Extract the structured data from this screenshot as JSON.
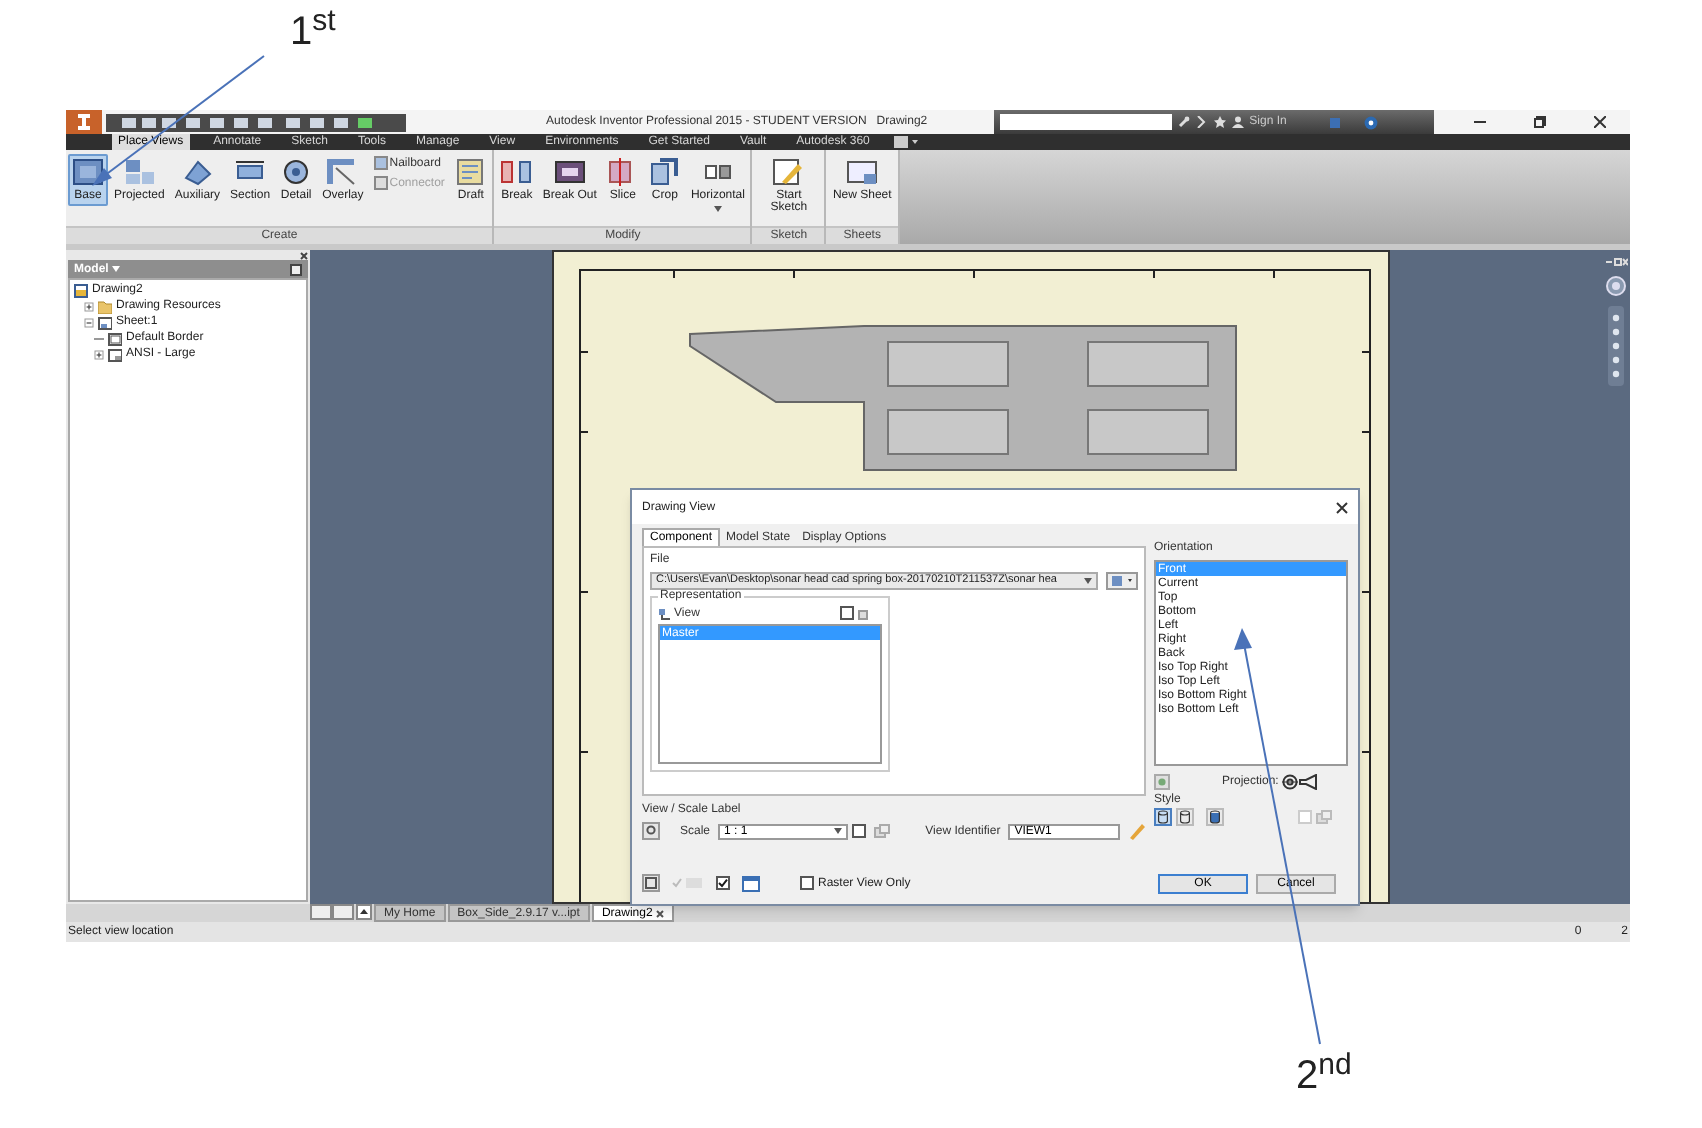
{
  "annotations": [
    {
      "text": "1$^{st}$"
    },
    {
      "text": "2$^{nd}$"
    }
  ],
  "title_bar": {
    "app_title": "Autodesk Inventor Professional 2015 - STUDENT VERSION",
    "document": "Drawing2",
    "sign_in": "Sign In"
  },
  "ribbon_tabs": [
    {
      "label": "Place Views",
      "selected": true
    },
    {
      "label": "Annotate",
      "selected": false
    },
    {
      "label": "Sketch",
      "selected": false
    },
    {
      "label": "Tools",
      "selected": false
    },
    {
      "label": "Manage",
      "selected": false
    },
    {
      "label": "View",
      "selected": false
    },
    {
      "label": "Environments",
      "selected": false
    },
    {
      "label": "Get Started",
      "selected": false
    },
    {
      "label": "Vault",
      "selected": false
    },
    {
      "label": "Autodesk 360",
      "selected": false
    }
  ],
  "ribbon_groups": [
    {
      "label": "Create",
      "items": [
        {
          "kind": "large",
          "label": "Base",
          "selected": true
        },
        {
          "kind": "large",
          "label": "Projected",
          "selected": false
        },
        {
          "kind": "large",
          "label": "Auxiliary",
          "selected": false
        },
        {
          "kind": "large",
          "label": "Section",
          "selected": false
        },
        {
          "kind": "large",
          "label": "Detail",
          "selected": false
        },
        {
          "kind": "large",
          "label": "Overlay",
          "selected": false
        },
        {
          "kind": "stack",
          "buttons": [
            {
              "label": "Nailboard",
              "disabled": false
            },
            {
              "label": "Connector",
              "disabled": true
            }
          ]
        },
        {
          "kind": "large",
          "label": "Draft",
          "selected": false
        }
      ]
    },
    {
      "label": "Modify",
      "items": [
        {
          "kind": "large",
          "label": "Break",
          "selected": false
        },
        {
          "kind": "large",
          "label": "Break Out",
          "selected": false
        },
        {
          "kind": "large",
          "label": "Slice",
          "selected": false
        },
        {
          "kind": "large",
          "label": "Crop",
          "selected": false
        },
        {
          "kind": "large",
          "label": "Horizontal",
          "selected": false
        }
      ]
    },
    {
      "label": "Sketch",
      "items": [
        {
          "kind": "large",
          "label": "Start Sketch",
          "selected": false
        }
      ]
    },
    {
      "label": "Sheets",
      "items": [
        {
          "kind": "large",
          "label": "New Sheet",
          "selected": false
        }
      ]
    }
  ],
  "browser": {
    "header": "Model",
    "tree": [
      {
        "label": "Drawing2",
        "kind": "drawing",
        "children": [
          {
            "label": "Drawing Resources",
            "kind": "folder",
            "expanded": false
          },
          {
            "label": "Sheet:1",
            "kind": "sheet",
            "expanded": true,
            "children": [
              {
                "label": "Default Border",
                "kind": "border"
              },
              {
                "label": "ANSI - Large",
                "kind": "titleblock",
                "expanded": false
              }
            ]
          }
        ]
      }
    ]
  },
  "dialog": {
    "title": "Drawing View",
    "tabs": [
      {
        "label": "Component",
        "selected": true
      },
      {
        "label": "Model State",
        "selected": false
      },
      {
        "label": "Display Options",
        "selected": false
      }
    ],
    "file_label": "File",
    "file_path": "C:\\Users\\Evan\\Desktop\\sonar head cad spring box-20170210T211537Z\\sonar hea",
    "representation_label": "Representation",
    "view_label": "View",
    "view_checkbox": {
      "checked": false
    },
    "representations": [
      {
        "label": "Master",
        "selected": true
      }
    ],
    "view_scale_label": "View / Scale Label",
    "scale_label": "Scale",
    "scale_value": "1 : 1",
    "scale_checkbox": {
      "checked": false
    },
    "view_identifier_label": "View Identifier",
    "view_identifier": "VIEW1",
    "orientation_label": "Orientation",
    "orientations": [
      {
        "label": "Front",
        "selected": true
      },
      {
        "label": "Current",
        "selected": false
      },
      {
        "label": "Top",
        "selected": false
      },
      {
        "label": "Bottom",
        "selected": false
      },
      {
        "label": "Left",
        "selected": false
      },
      {
        "label": "Right",
        "selected": false
      },
      {
        "label": "Back",
        "selected": false
      },
      {
        "label": "Iso Top Right",
        "selected": false
      },
      {
        "label": "Iso Top Left",
        "selected": false
      },
      {
        "label": "Iso Bottom Right",
        "selected": false
      },
      {
        "label": "Iso Bottom Left",
        "selected": false
      }
    ],
    "projection_label": "Projection:",
    "style_label": "Style",
    "styles": [
      {
        "selected": true
      },
      {
        "selected": false
      },
      {
        "selected": false
      }
    ],
    "style_checkbox": {
      "checked": false
    },
    "options_checkbox": {
      "checked": true
    },
    "raster": {
      "label": "Raster View Only",
      "checked": false
    },
    "ok": "OK",
    "cancel": "Cancel"
  },
  "document_tabs": [
    {
      "label": "My Home",
      "selected": false
    },
    {
      "label": "Box_Side_2.9.17 v...ipt",
      "selected": false
    },
    {
      "label": "Drawing2",
      "selected": true
    }
  ],
  "status_bar": {
    "message": "Select view location",
    "values": [
      "0",
      "2"
    ]
  }
}
